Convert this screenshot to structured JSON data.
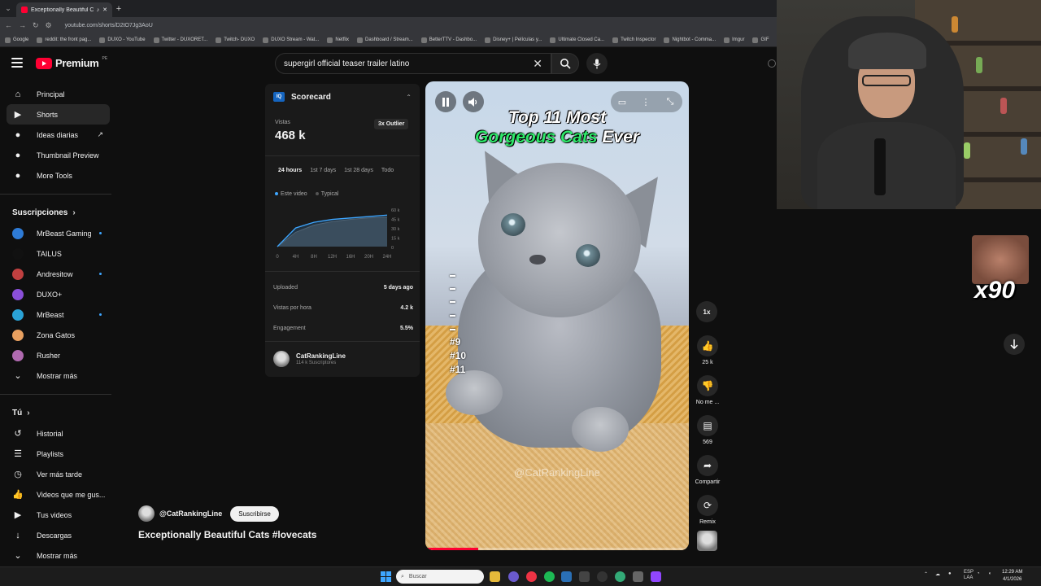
{
  "browser": {
    "tab_title": "Exceptionally Beautiful Cat",
    "new_tab_symbol": "+",
    "url": "youtube.com/shorts/D2tO7Jg3AoU",
    "bookmarks": [
      "Google",
      "reddit: the front pag...",
      "DUXO - YouTube",
      "Twitter - DUXORET...",
      "Twitch- DUXO",
      "DUXO Stream - Wat...",
      "Netflix",
      "Dashboard / Stream...",
      "BetterTTV - Dashbo...",
      "Disney+ | Películas y...",
      "Ultimate Closed Ca...",
      "Twitch Inspector",
      "Nightbot - Comma...",
      "Imgur",
      "GIF"
    ]
  },
  "header": {
    "logo_word": "Premium",
    "logo_country": "PE",
    "search_query": "supergirl official teaser trailer latino",
    "clear_symbol": "✕"
  },
  "sidebar": {
    "main": [
      {
        "label": "Principal",
        "icon": "home-icon",
        "glyph": "⌂"
      },
      {
        "label": "Shorts",
        "icon": "shorts-icon",
        "glyph": "▶"
      },
      {
        "label": "Ideas diarias",
        "icon": "ideas-icon",
        "glyph": "●"
      },
      {
        "label": "Thumbnail Preview",
        "icon": "thumbnail-icon",
        "glyph": "●"
      },
      {
        "label": "More Tools",
        "icon": "tools-icon",
        "glyph": "●"
      }
    ],
    "subscriptions_header": "Suscripciones",
    "subscriptions": [
      {
        "label": "MrBeast Gaming",
        "color": "#2e7bd6",
        "new": true
      },
      {
        "label": "TAILUS",
        "color": "#111111",
        "new": false
      },
      {
        "label": "Andresitow",
        "color": "#c04040",
        "new": true
      },
      {
        "label": "DUXO+",
        "color": "#8a4fd8",
        "new": false
      },
      {
        "label": "MrBeast",
        "color": "#2aa2d6",
        "new": true
      },
      {
        "label": "Zona Gatos",
        "color": "#e8a060",
        "new": false
      },
      {
        "label": "Rusher",
        "color": "#b06ab0",
        "new": false
      }
    ],
    "show_more_1": "Mostrar más",
    "you_header": "Tú",
    "you_items": [
      {
        "label": "Historial",
        "icon": "history-icon",
        "glyph": "↺"
      },
      {
        "label": "Playlists",
        "icon": "playlists-icon",
        "glyph": "☰"
      },
      {
        "label": "Ver más tarde",
        "icon": "watch-later-icon",
        "glyph": "◷"
      },
      {
        "label": "Videos que me gus...",
        "icon": "liked-icon",
        "glyph": "👍"
      },
      {
        "label": "Tus videos",
        "icon": "your-videos-icon",
        "glyph": "▶"
      },
      {
        "label": "Descargas",
        "icon": "downloads-icon",
        "glyph": "↓"
      }
    ],
    "show_more_2": "Mostrar más"
  },
  "scorecard": {
    "title": "Scorecard",
    "logo_text": "IQ",
    "views_label": "Vistas",
    "views": "468 k",
    "outlier": "3x Outlier",
    "tabs": [
      "24 hours",
      "1st 7 days",
      "1st 28 days",
      "Todo"
    ],
    "legend": [
      "Este video",
      "Typical"
    ],
    "rows": [
      {
        "label": "Uploaded",
        "value": "5 days ago"
      },
      {
        "label": "Vistas por hora",
        "value": "4.2 k"
      },
      {
        "label": "Engagement",
        "value": "5.5%"
      }
    ],
    "channel_name": "CatRankingLine",
    "channel_subs": "114 k Suscriptores"
  },
  "chart_data": {
    "type": "area",
    "x": [
      "0",
      "4H",
      "8H",
      "12H",
      "16H",
      "20H",
      "24H"
    ],
    "xlabel": "",
    "ylabel": "",
    "ylim": [
      0,
      50
    ],
    "yticks": [
      "60 k",
      "45 k",
      "30 k",
      "15 k",
      "0"
    ],
    "grid": false,
    "series": [
      {
        "name": "Este video",
        "color": "#3ea6ff",
        "values": [
          0,
          26,
          34,
          38,
          40,
          42,
          44
        ]
      },
      {
        "name": "Typical",
        "color": "#555555",
        "values": [
          0,
          20,
          30,
          35,
          38,
          40,
          41
        ]
      }
    ]
  },
  "video": {
    "title_line1": "Top 11 Most",
    "title_word_green": "Gorgeous Cats",
    "title_word_white": "Ever",
    "ranks": [
      "#9",
      "#10",
      "#11"
    ],
    "watermark": "@CatRankingLine",
    "progress": 0.2
  },
  "actions": {
    "speed": "1x",
    "likes": "25 k",
    "dislike": "No me ...",
    "comments": "569",
    "share": "Compartir",
    "remix": "Remix"
  },
  "short": {
    "channel": "@CatRankingLine",
    "subscribe": "Suscribirse",
    "title": "Exceptionally Beautiful Cats #lovecats"
  },
  "overlay": {
    "emote_count": "x90"
  },
  "taskbar": {
    "search": "Buscar",
    "lang": "ESP",
    "lang2": "LAA",
    "time": "12:29 AM",
    "date": "4/1/2026"
  }
}
